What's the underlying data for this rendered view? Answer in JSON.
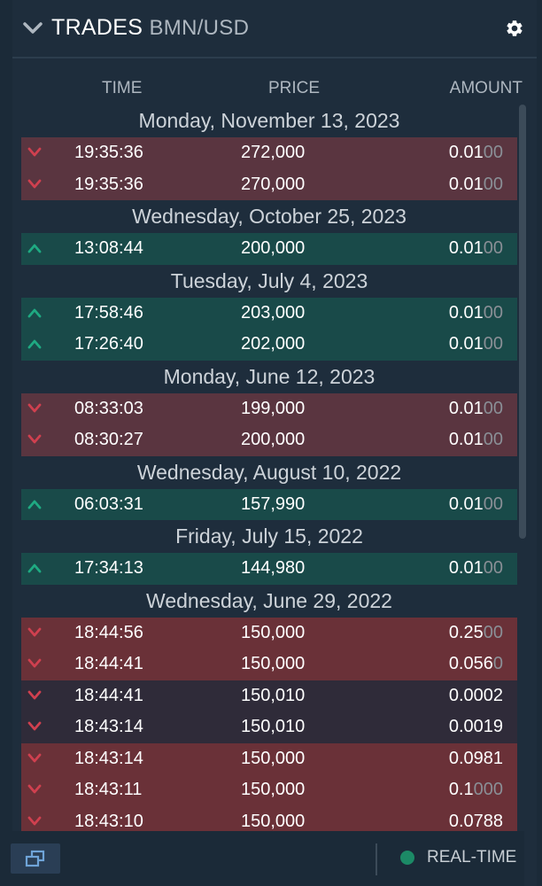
{
  "header": {
    "title": "TRADES",
    "pair": "BMN/USD"
  },
  "columns": {
    "time": "TIME",
    "price": "PRICE",
    "amount": "AMOUNT"
  },
  "groups": [
    {
      "date": "Monday, November 13, 2023",
      "trades": [
        {
          "dir": "down",
          "time": "19:35:36",
          "price": "272,000",
          "amount_main": "0.01",
          "amount_faded": "00",
          "shade": "normal"
        },
        {
          "dir": "down",
          "time": "19:35:36",
          "price": "270,000",
          "amount_main": "0.01",
          "amount_faded": "00",
          "shade": "normal"
        }
      ]
    },
    {
      "date": "Wednesday, October 25, 2023",
      "trades": [
        {
          "dir": "up",
          "time": "13:08:44",
          "price": "200,000",
          "amount_main": "0.01",
          "amount_faded": "00",
          "shade": "normal"
        }
      ]
    },
    {
      "date": "Tuesday, July 4, 2023",
      "trades": [
        {
          "dir": "up",
          "time": "17:58:46",
          "price": "203,000",
          "amount_main": "0.01",
          "amount_faded": "00",
          "shade": "normal"
        },
        {
          "dir": "up",
          "time": "17:26:40",
          "price": "202,000",
          "amount_main": "0.01",
          "amount_faded": "00",
          "shade": "normal"
        }
      ]
    },
    {
      "date": "Monday, June 12, 2023",
      "trades": [
        {
          "dir": "down",
          "time": "08:33:03",
          "price": "199,000",
          "amount_main": "0.01",
          "amount_faded": "00",
          "shade": "normal"
        },
        {
          "dir": "down",
          "time": "08:30:27",
          "price": "200,000",
          "amount_main": "0.01",
          "amount_faded": "00",
          "shade": "normal"
        }
      ]
    },
    {
      "date": "Wednesday, August 10, 2022",
      "trades": [
        {
          "dir": "up",
          "time": "06:03:31",
          "price": "157,990",
          "amount_main": "0.01",
          "amount_faded": "00",
          "shade": "normal"
        }
      ]
    },
    {
      "date": "Friday, July 15, 2022",
      "trades": [
        {
          "dir": "up",
          "time": "17:34:13",
          "price": "144,980",
          "amount_main": "0.01",
          "amount_faded": "00",
          "shade": "normal"
        }
      ]
    },
    {
      "date": "Wednesday, June 29, 2022",
      "trades": [
        {
          "dir": "down",
          "time": "18:44:56",
          "price": "150,000",
          "amount_main": "0.25",
          "amount_faded": "00",
          "shade": "strong"
        },
        {
          "dir": "down",
          "time": "18:44:41",
          "price": "150,000",
          "amount_main": "0.056",
          "amount_faded": "0",
          "shade": "strong"
        },
        {
          "dir": "down",
          "time": "18:44:41",
          "price": "150,010",
          "amount_main": "0.0002",
          "amount_faded": "",
          "shade": "dim"
        },
        {
          "dir": "down",
          "time": "18:43:14",
          "price": "150,010",
          "amount_main": "0.0019",
          "amount_faded": "",
          "shade": "dim"
        },
        {
          "dir": "down",
          "time": "18:43:14",
          "price": "150,000",
          "amount_main": "0.0981",
          "amount_faded": "",
          "shade": "strong"
        },
        {
          "dir": "down",
          "time": "18:43:11",
          "price": "150,000",
          "amount_main": "0.1",
          "amount_faded": "000",
          "shade": "strong"
        },
        {
          "dir": "down",
          "time": "18:43:10",
          "price": "150,000",
          "amount_main": "0.0788",
          "amount_faded": "",
          "shade": "strong"
        }
      ]
    }
  ],
  "footer": {
    "status_label": "REAL-TIME"
  },
  "icons": {
    "collapse": "chevron-down-icon",
    "settings": "gear-icon",
    "sell": "chevron-down-icon",
    "buy": "chevron-up-icon",
    "popout": "popout-window-icon"
  },
  "colors": {
    "panel_bg": "#1e2d3c",
    "sell_row": "#5a3540",
    "buy_row": "#194a49",
    "sell_icon": "#d0404f",
    "buy_icon": "#1faa82",
    "realtime_dot": "#1c8a66"
  }
}
